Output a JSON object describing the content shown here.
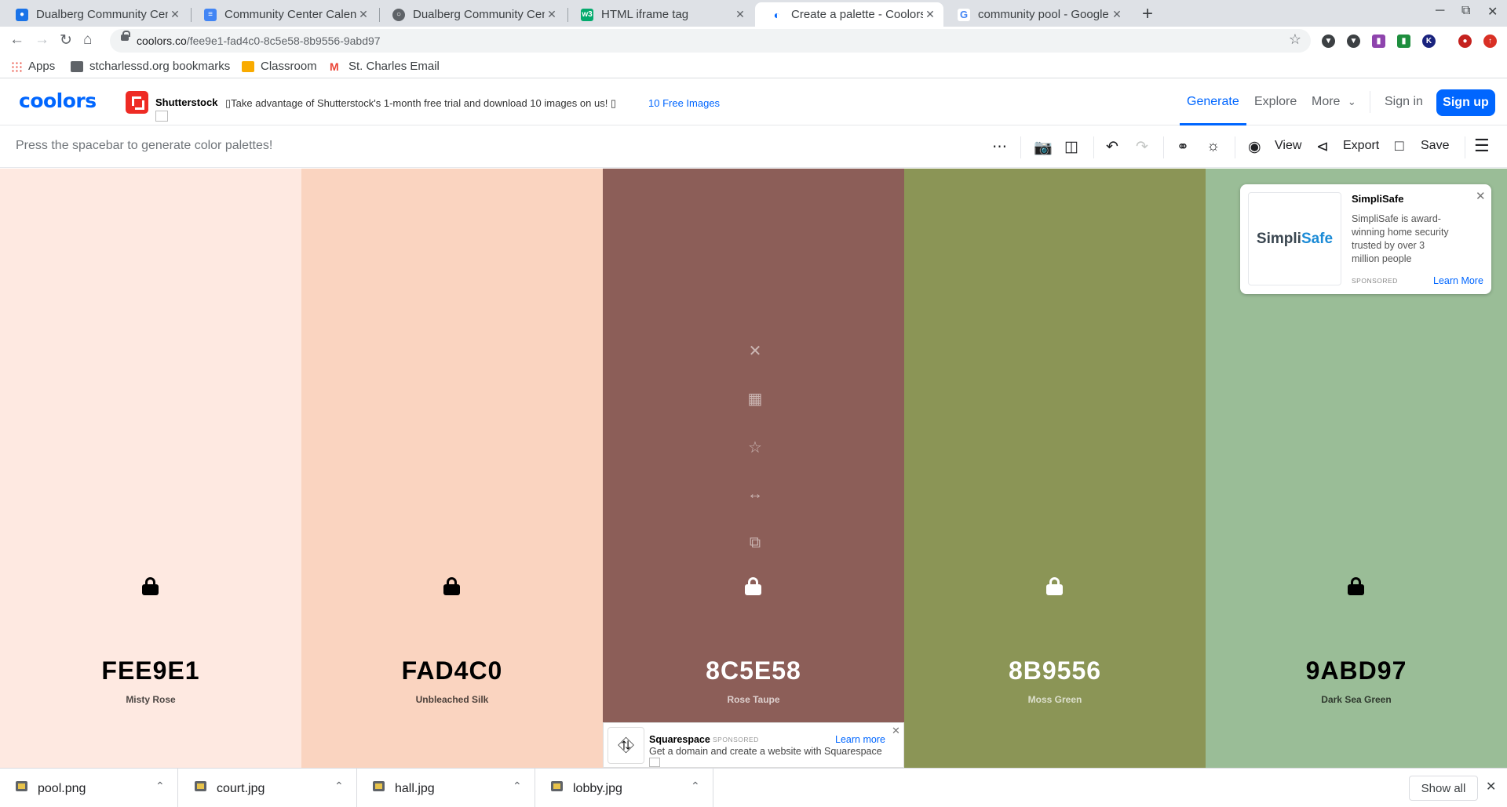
{
  "browser": {
    "tabs": [
      {
        "title": "Dualberg Community Cen",
        "favicon": "contacts-icon",
        "color": "#1a73e8"
      },
      {
        "title": "Community Center Calend",
        "favicon": "docs-icon",
        "color": "#4285f4"
      },
      {
        "title": "Dualberg Community Cen",
        "favicon": "globe-icon",
        "color": "#5f6368"
      },
      {
        "title": "HTML iframe tag",
        "favicon": "w3schools-icon",
        "color": "#04aa6d"
      },
      {
        "title": "Create a palette - Coolors",
        "favicon": "coolors-icon",
        "color": "#0066ff",
        "active": true
      },
      {
        "title": "community pool - Google S",
        "favicon": "google-icon",
        "color": "#4285f4"
      }
    ],
    "url_host": "coolors.co",
    "url_path": "/fee9e1-fad4c0-8c5e58-8b9556-9abd97",
    "bookmarks": [
      {
        "label": "Apps",
        "icon": "apps-grid-icon"
      },
      {
        "label": "stcharlessd.org bookmarks",
        "icon": "folder-icon"
      },
      {
        "label": "Classroom",
        "icon": "classroom-icon"
      },
      {
        "label": "St. Charles Email",
        "icon": "gmail-icon"
      }
    ]
  },
  "header": {
    "logo": "coolors",
    "ad": {
      "brand": "Shutterstock",
      "text": "▯Take advantage of Shutterstock's 1-month free trial and download 10 images on us! ▯",
      "cta": "10 Free Images"
    },
    "nav": {
      "generate": "Generate",
      "explore": "Explore",
      "more": "More",
      "signin": "Sign in",
      "signup": "Sign up"
    }
  },
  "toolbar": {
    "hint": "Press the spacebar to generate color palettes!",
    "view": "View",
    "export": "Export",
    "save": "Save"
  },
  "palette": [
    {
      "hex": "FEE9E1",
      "name": "Misty Rose",
      "color": "#fee9e1",
      "text_color": "#000000"
    },
    {
      "hex": "FAD4C0",
      "name": "Unbleached Silk",
      "color": "#fad4c0",
      "text_color": "#000000"
    },
    {
      "hex": "8C5E58",
      "name": "Rose Taupe",
      "color": "#8c5e58",
      "text_color": "#ffffff",
      "hovered": true
    },
    {
      "hex": "8B9556",
      "name": "Moss Green",
      "color": "#8b9556",
      "text_color": "#ffffff"
    },
    {
      "hex": "9ABD97",
      "name": "Dark Sea Green",
      "color": "#9abd97",
      "text_color": "#000000"
    }
  ],
  "ads": {
    "simplisafe": {
      "title": "SimpliSafe",
      "logo_a": "Simpli",
      "logo_b": "Safe",
      "description": "SimpliSafe is award-winning home security trusted by over 3 million people",
      "sponsored": "SPONSORED",
      "cta": "Learn More"
    },
    "squarespace": {
      "title": "Squarespace",
      "sponsored": "SPONSORED",
      "description": "Get a domain and create a website with Squarespace",
      "cta": "Learn more"
    }
  },
  "downloads": {
    "files": [
      "pool.png",
      "court.jpg",
      "hall.jpg",
      "lobby.jpg"
    ],
    "show_all": "Show all"
  }
}
